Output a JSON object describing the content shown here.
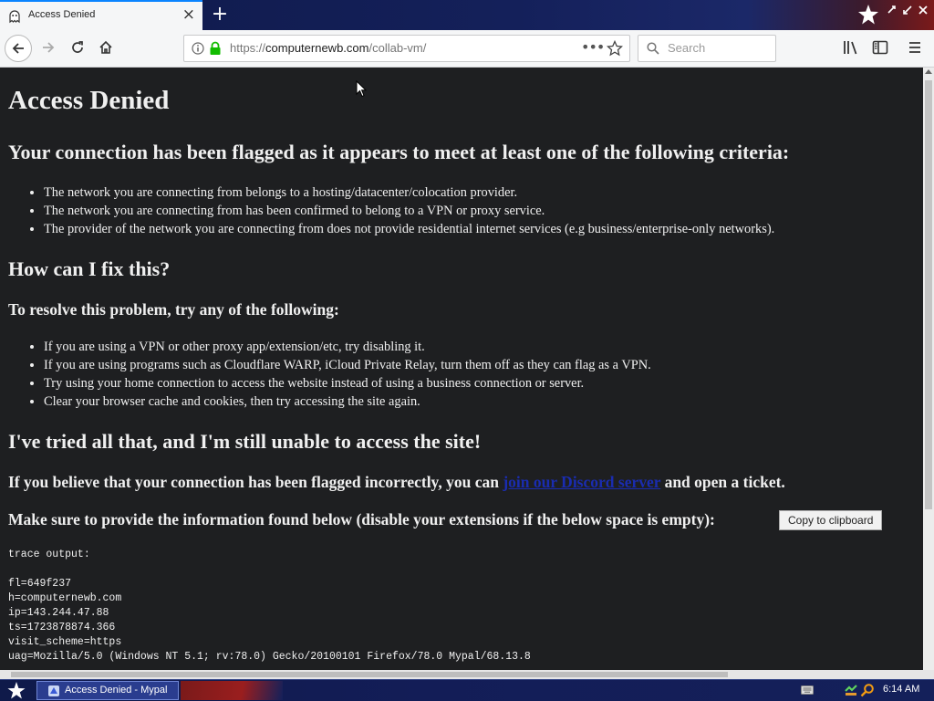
{
  "browser": {
    "tab": {
      "title": "Access Denied",
      "close_glyph": "×",
      "favicon": "ghost-icon"
    },
    "new_tab_glyph": "+",
    "url": {
      "scheme": "https://",
      "host": "computernewb.com",
      "path": "/collab-vm/"
    },
    "page_action_glyph": "•••",
    "search_placeholder": "Search"
  },
  "page": {
    "title": "Access Denied",
    "criteria_heading": "Your connection has been flagged as it appears to meet at least one of the following criteria:",
    "criteria": [
      "The network you are connecting from belongs to a hosting/datacenter/colocation provider.",
      "The network you are connecting from has been confirmed to belong to a VPN or proxy service.",
      "The provider of the network you are connecting from does not provide residential internet services (e.g business/enterprise-only networks)."
    ],
    "fix_heading": "How can I fix this?",
    "resolve_heading": "To resolve this problem, try any of the following:",
    "resolve": [
      "If you are using a VPN or other proxy app/extension/etc, try disabling it.",
      "If you are using programs such as Cloudflare WARP, iCloud Private Relay, turn them off as they can flag as a VPN.",
      "Try using your home connection to access the website instead of using a business connection or server.",
      "Clear your browser cache and cookies, then try accessing the site again."
    ],
    "tried_heading": "I've tried all that, and I'm still unable to access the site!",
    "discord_before": "If you believe that your connection has been flagged incorrectly, you can ",
    "discord_link": "join our Discord server",
    "discord_after": " and open a ticket.",
    "provide_text": "Make sure to provide the information found below (disable your extensions if the below space is empty):",
    "copy_button": "Copy to clipboard",
    "trace": "trace output:\n\nfl=649f237\nh=computernewb.com\nip=143.244.47.88\nts=1723878874.366\nvisit_scheme=https\nuag=Mozilla/5.0 (Windows NT 5.1; rv:78.0) Gecko/20100101 Firefox/78.0 Mypal/68.13.8"
  },
  "taskbar": {
    "task_label": "Access Denied - Mypal",
    "clock": "6:14 AM"
  },
  "colors": {
    "page_background": "#1e1f21",
    "page_text": "#f0f0f0",
    "link": "#1a2cb0",
    "lock_green": "#12bc00",
    "taskbar": "#14205a"
  }
}
